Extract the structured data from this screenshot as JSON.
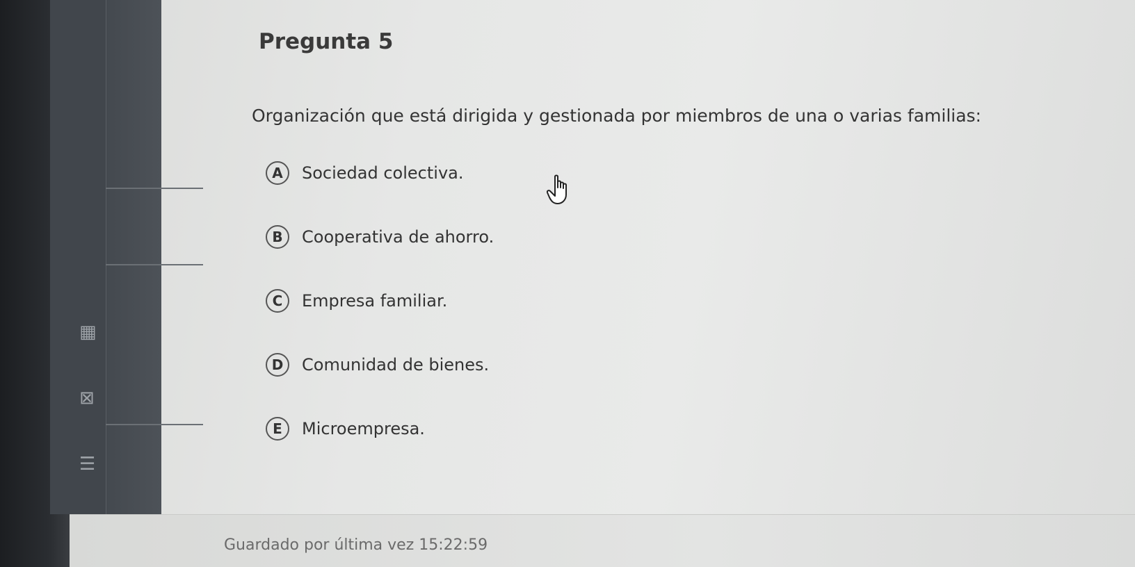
{
  "question": {
    "title": "Pregunta 5",
    "text": "Organización que está dirigida y gestionada por miembros de una o varias familias:",
    "options": [
      {
        "letter": "A",
        "label": "Sociedad colectiva."
      },
      {
        "letter": "B",
        "label": "Cooperativa de ahorro."
      },
      {
        "letter": "C",
        "label": "Empresa familiar."
      },
      {
        "letter": "D",
        "label": "Comunidad de bienes."
      },
      {
        "letter": "E",
        "label": "Microempresa."
      }
    ]
  },
  "footer": {
    "saved_text": "Guardado por última vez 15:22:59"
  },
  "icons": {
    "cursor": "hand-pointer-icon"
  }
}
